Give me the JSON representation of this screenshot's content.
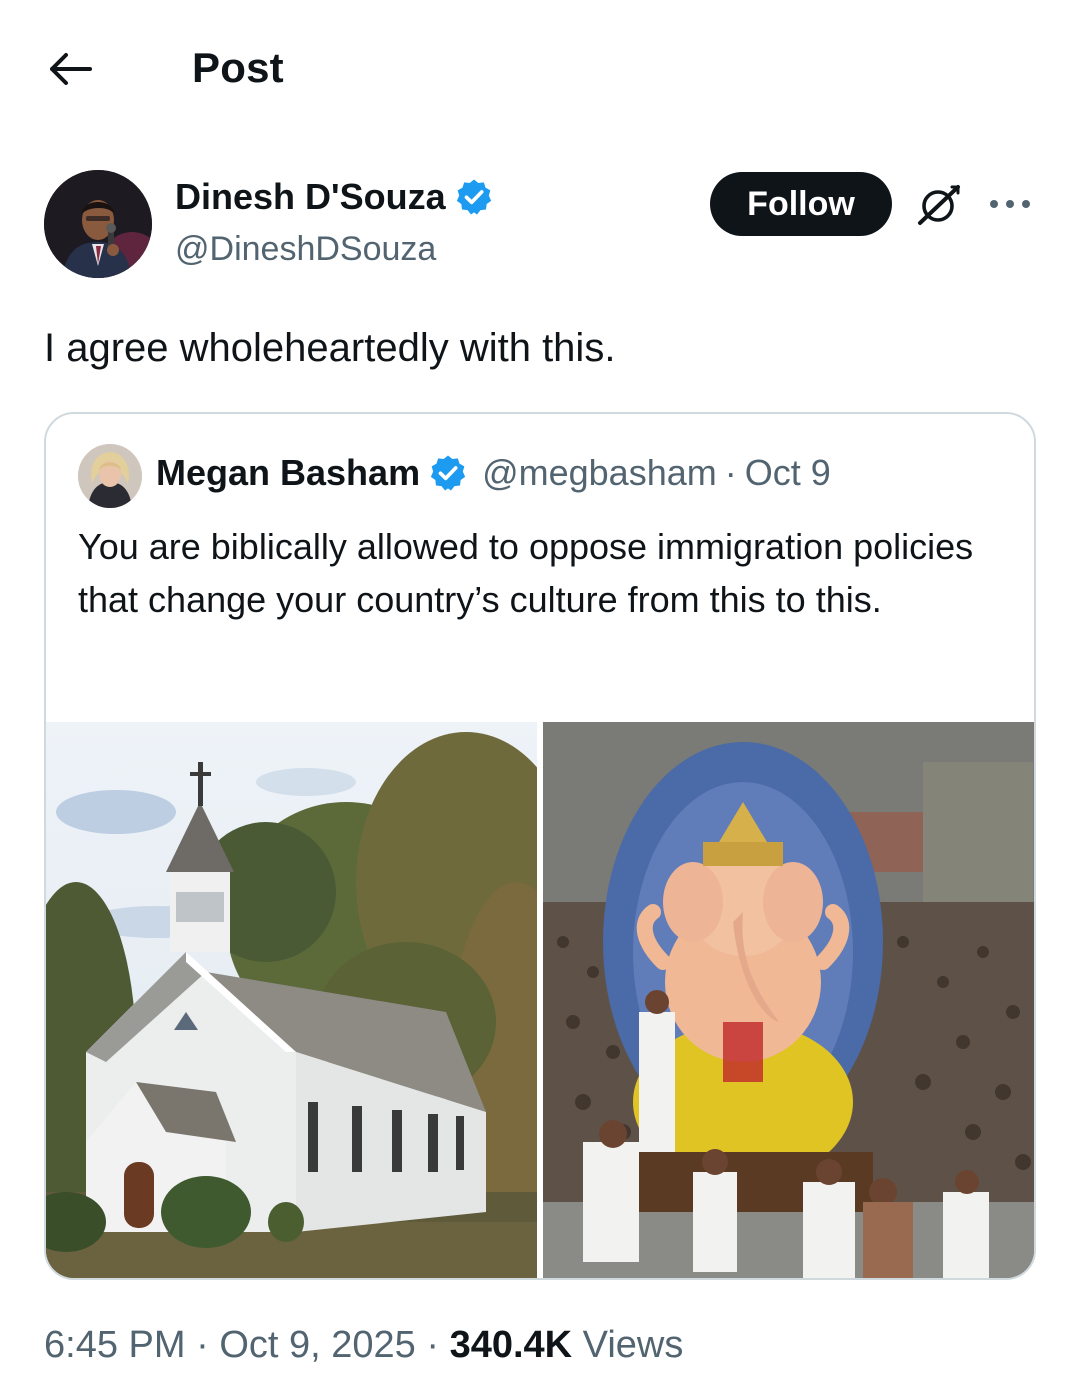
{
  "header": {
    "title": "Post",
    "back_icon": "arrow-left-icon"
  },
  "author": {
    "name": "Dinesh D'Souza",
    "handle": "@DineshDSouza",
    "verified": true,
    "follow_label": "Follow"
  },
  "post": {
    "text": "I agree wholeheartedly with this."
  },
  "quote": {
    "name": "Megan Basham",
    "handle": "@megbasham",
    "separator": "·",
    "date": "Oct 9",
    "verified": true,
    "text": "You are biblically allowed to oppose immigration policies that change your country’s culture from this to this.",
    "media": [
      {
        "subject": "white wooden church with steeple among trees"
      },
      {
        "subject": "large Ganesh idol carried through a crowd"
      }
    ]
  },
  "meta": {
    "time": "6:45 PM",
    "separator": "·",
    "date": "Oct 9, 2025",
    "views_count": "340.4K",
    "views_label": "Views"
  },
  "colors": {
    "text": "#0f1419",
    "secondary": "#536471",
    "verified_blue": "#1d9bf0",
    "border": "#cfd9de"
  }
}
